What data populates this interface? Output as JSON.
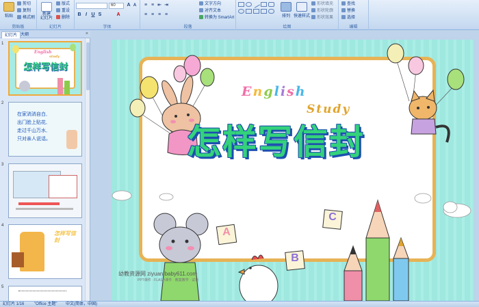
{
  "ribbon": {
    "groups": [
      {
        "name": "剪贴板",
        "big": "粘贴",
        "small": [
          "剪切",
          "复制",
          "格式刷"
        ]
      },
      {
        "name": "幻灯片",
        "big": "新建\n幻灯片",
        "small": [
          "版式",
          "重设",
          "删除"
        ]
      },
      {
        "name": "字体"
      },
      {
        "name": "段落",
        "small": [
          "文字方向",
          "对齐文本",
          "转换为 SmartArt"
        ]
      },
      {
        "name": "绘图",
        "big": [
          "排列",
          "快速样式"
        ],
        "small": [
          "形状填充",
          "形状轮廓",
          "形状效果"
        ]
      },
      {
        "name": "编辑",
        "small": [
          "查找",
          "替换",
          "选择"
        ]
      }
    ],
    "font_name": "",
    "font_size": "60",
    "font_buttons": [
      "B",
      "I",
      "U",
      "S",
      "A"
    ]
  },
  "left_panel": {
    "tabs": [
      "幻灯片",
      "大纲"
    ],
    "close": "×",
    "slides": [
      {
        "num": "1",
        "title": "怎样写信封",
        "english": "English",
        "study": "study"
      },
      {
        "num": "2",
        "lines": [
          "在家淌淌自白,",
          "出门脸上贴花,",
          "走过千山万水,",
          "只对亲人说话。"
        ]
      },
      {
        "num": "3"
      },
      {
        "num": "4",
        "title": "怎样写信封"
      },
      {
        "num": "5"
      }
    ]
  },
  "slide": {
    "title": "怎样写信封",
    "english_letters": [
      {
        "ch": "E",
        "color": "#f06fa8"
      },
      {
        "ch": "n",
        "color": "#f6b93a"
      },
      {
        "ch": "g",
        "color": "#8ccc4a"
      },
      {
        "ch": "l",
        "color": "#49b6e8"
      },
      {
        "ch": "i",
        "color": "#a77ad8"
      },
      {
        "ch": "s",
        "color": "#f06fa8"
      },
      {
        "ch": "h",
        "color": "#49b6e8"
      }
    ],
    "study": "Study",
    "blocks": [
      "A",
      "B",
      "C"
    ],
    "watermark": "幼教资源网 ziyuan.baby611.com",
    "watermark_sub": "PPT课件 · FLASH课件 · 教案教学 · 试卷"
  },
  "status": {
    "slide": "幻灯片 1/16",
    "theme": "\"Office 主题\"",
    "language": "中文(简体，中国)"
  },
  "colors": {
    "ribbon_bg": "#cddff3",
    "title_green": "#34d27b",
    "title_outline": "#1d4fb0",
    "frame": "#e7b355",
    "slide_bg": "#a6ece4"
  }
}
